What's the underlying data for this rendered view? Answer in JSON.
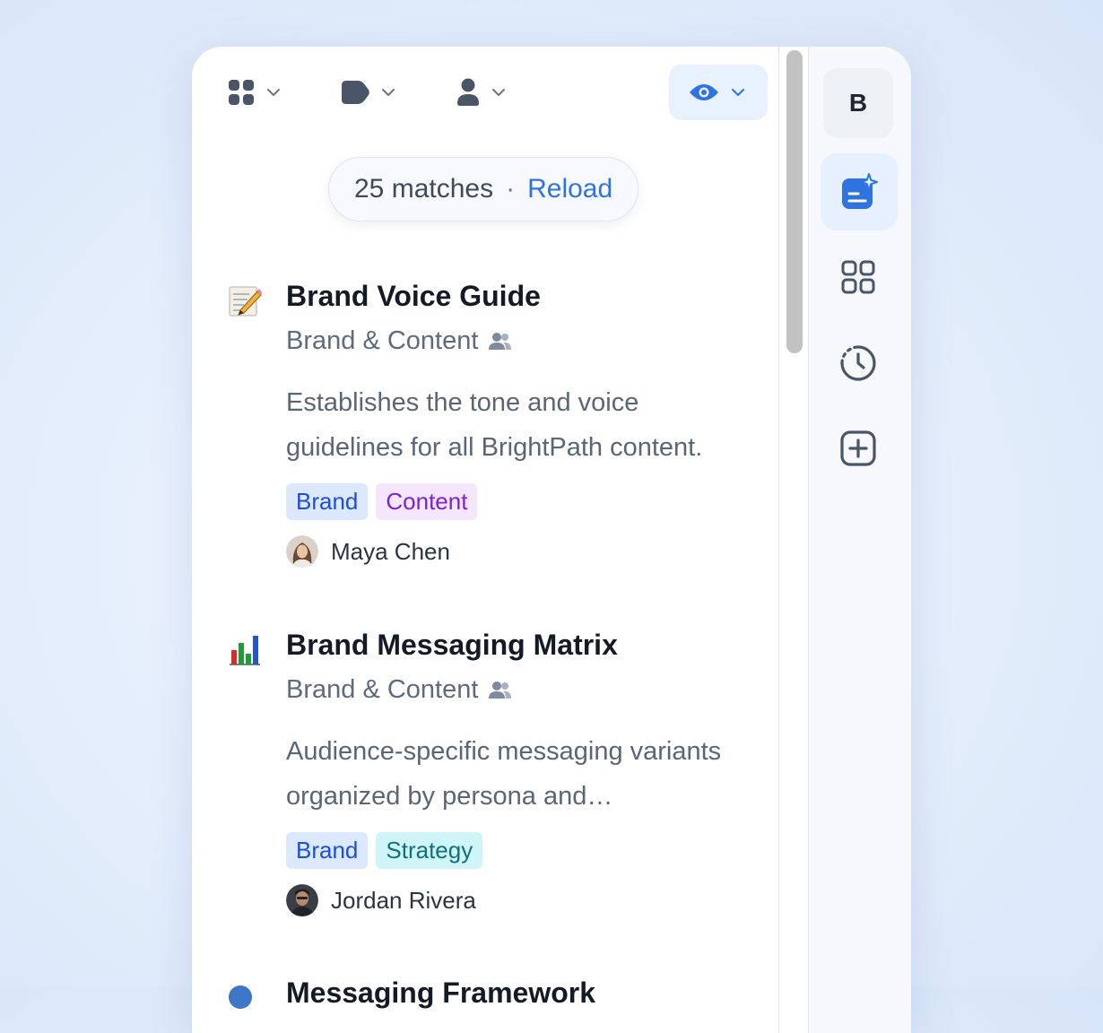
{
  "toolbar": {
    "filters": [
      {
        "icon": "grid-icon"
      },
      {
        "icon": "tag-icon"
      },
      {
        "icon": "person-icon"
      },
      {
        "icon": "eye-icon",
        "active": true
      }
    ]
  },
  "results": {
    "count_text": "25 matches",
    "separator": "·",
    "reload_label": "Reload"
  },
  "documents": [
    {
      "emoji": "memo-icon",
      "title": "Brand Voice Guide",
      "team": "Brand & Content",
      "description": "Establishes the tone and voice guidelines for all BrightPath content.",
      "tags": [
        "Brand",
        "Content"
      ],
      "author": "Maya Chen"
    },
    {
      "emoji": "bar-chart-icon",
      "title": "Brand Messaging Matrix",
      "team": "Brand & Content",
      "description": "Audience-specific messaging variants organized by persona and…",
      "tags": [
        "Brand",
        "Strategy"
      ],
      "author": "Jordan Rivera"
    },
    {
      "emoji": "blue-circle-icon",
      "title": "Messaging Framework"
    }
  ],
  "rail": {
    "workspace_initial": "B",
    "items": [
      "workspace",
      "ai-notes-icon",
      "apps-grid-icon",
      "history-icon",
      "add-icon"
    ]
  },
  "colors": {
    "accent": "#2f73e0",
    "active_bg": "#e6f0fe",
    "tag_brand_bg": "#dce8fd",
    "tag_content_bg": "#f4e6fd",
    "tag_strategy_bg": "#cff5f8"
  }
}
